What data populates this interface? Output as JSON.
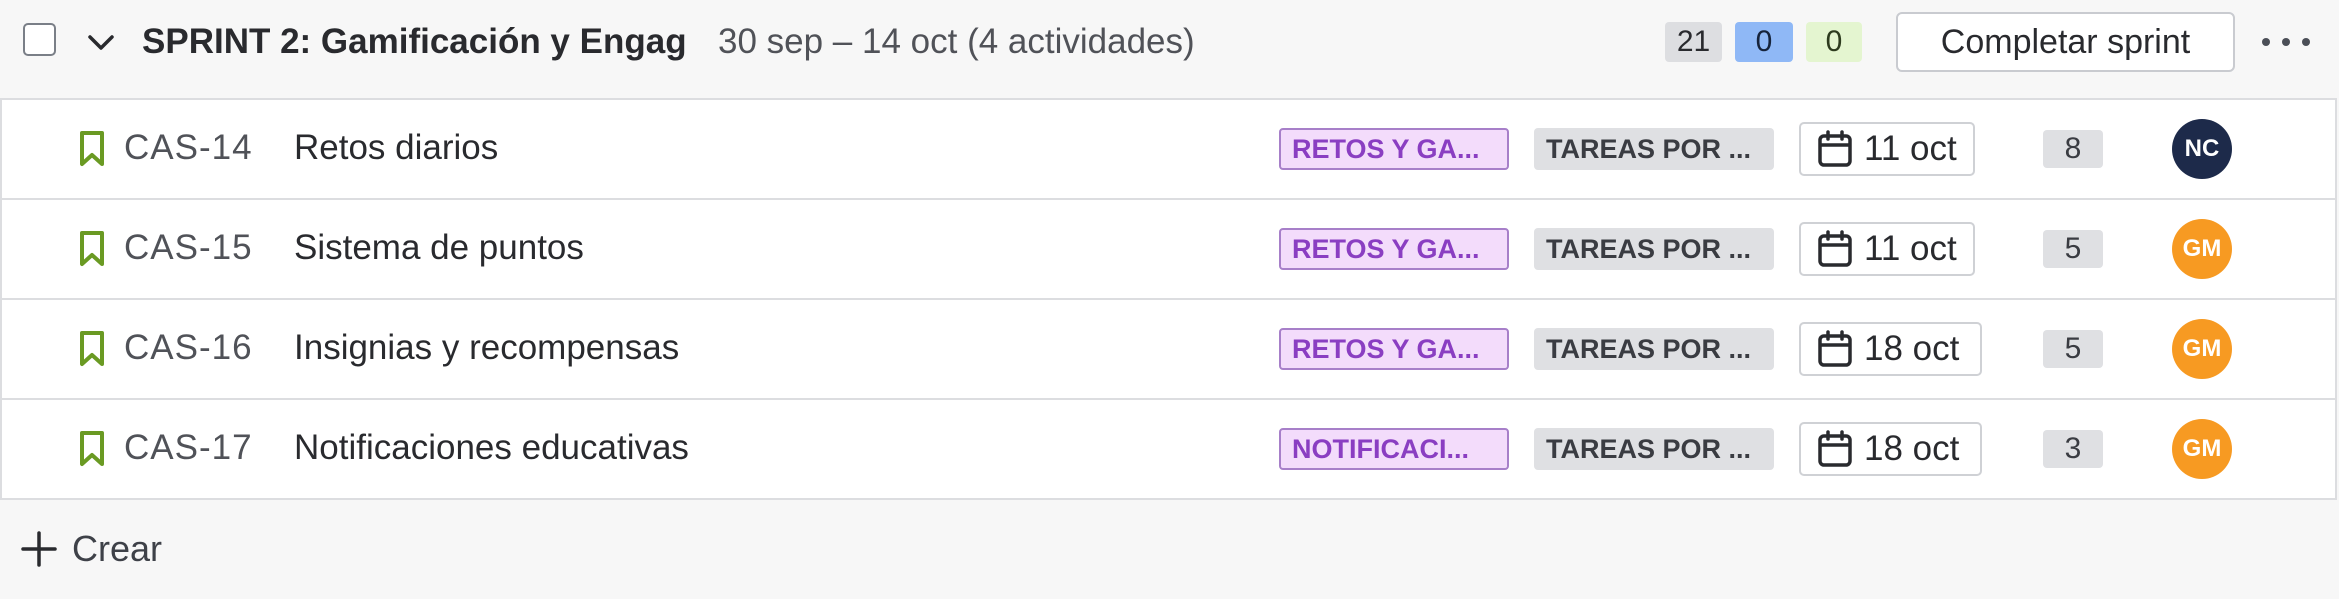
{
  "sprint": {
    "name": "SPRINT 2: Gamificación y Engag",
    "meta": "30 sep – 14 oct (4 actividades)",
    "counts": {
      "todo": "21",
      "in_progress": "0",
      "done": "0"
    },
    "complete_label": "Completar sprint"
  },
  "colors": {
    "story_icon": "#6a9a23",
    "epic_bg": "#f3dcfb",
    "epic_text": "#8a3ec2",
    "status_bg": "#dfe0e3",
    "count_in_progress": "#8fb8f6",
    "count_done": "#e4f5d0"
  },
  "issues": [
    {
      "key": "CAS-14",
      "summary": "Retos diarios",
      "epic": "RETOS Y GA...",
      "status": "TAREAS POR ...",
      "due": "11 oct",
      "points": "8",
      "assignee": "NC",
      "assignee_color": "#1d2a4a"
    },
    {
      "key": "CAS-15",
      "summary": "Sistema de puntos",
      "epic": "RETOS Y GA...",
      "status": "TAREAS POR ...",
      "due": "11 oct",
      "points": "5",
      "assignee": "GM",
      "assignee_color": "#f79a22"
    },
    {
      "key": "CAS-16",
      "summary": "Insignias y recompensas",
      "epic": "RETOS Y GA...",
      "status": "TAREAS POR ...",
      "due": "18 oct",
      "points": "5",
      "assignee": "GM",
      "assignee_color": "#f79a22"
    },
    {
      "key": "CAS-17",
      "summary": "Notificaciones educativas",
      "epic": "NOTIFICACI...",
      "status": "TAREAS POR ...",
      "due": "18 oct",
      "points": "3",
      "assignee": "GM",
      "assignee_color": "#f79a22"
    }
  ],
  "create": {
    "label": "Crear",
    "icon": "plus-icon"
  },
  "icons": {
    "story": "bookmark-icon",
    "date": "calendar-icon",
    "more": "more-horizontal-icon",
    "toggle": "chevron-down-icon"
  }
}
